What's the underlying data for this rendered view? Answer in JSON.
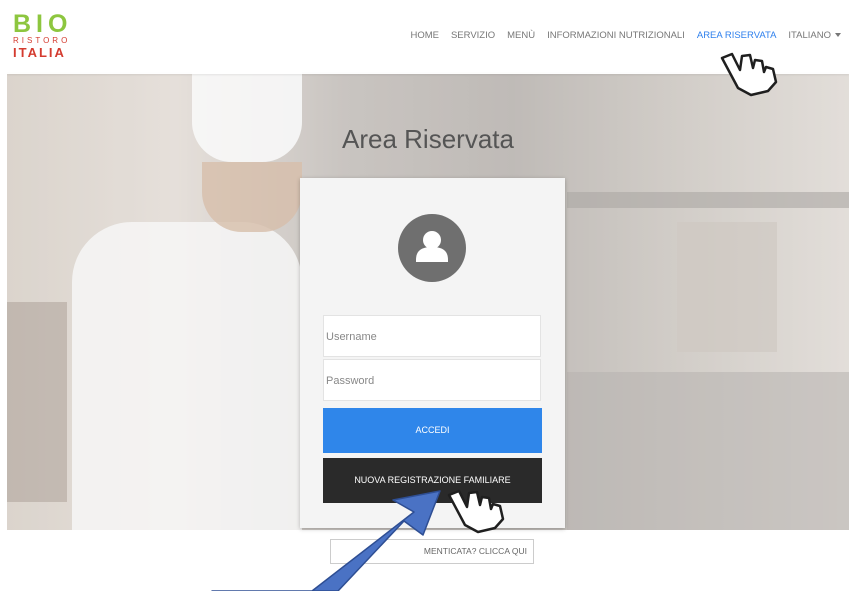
{
  "brand": {
    "line1": "BIO",
    "line2": "RISTORO",
    "line3": "ITALIA"
  },
  "nav": {
    "items": [
      {
        "label": "HOME"
      },
      {
        "label": "SERVIZIO"
      },
      {
        "label": "MENÙ"
      },
      {
        "label": "INFORMAZIONI NUTRIZIONALI"
      },
      {
        "label": "AREA RISERVATA",
        "active": true
      },
      {
        "label": "ITALIANO"
      }
    ]
  },
  "hero": {
    "title": "Area Riservata"
  },
  "login": {
    "username_placeholder": "Username",
    "password_placeholder": "Password",
    "login_button": "ACCEDI",
    "register_button": "NUOVA REGISTRAZIONE FAMILIARE"
  },
  "forgot": {
    "label": "MENTICATA? CLICCA QUI"
  },
  "colors": {
    "accent": "#2f86ea",
    "dark_button": "#2a2a2a",
    "logo_green": "#8dc63f",
    "logo_red": "#d43b2f",
    "annotation_arrow": "#4a72c4"
  },
  "icons": {
    "avatar": "user-avatar-icon",
    "pointer": "hand-pointer-icon",
    "dropdown": "caret-down-icon"
  }
}
